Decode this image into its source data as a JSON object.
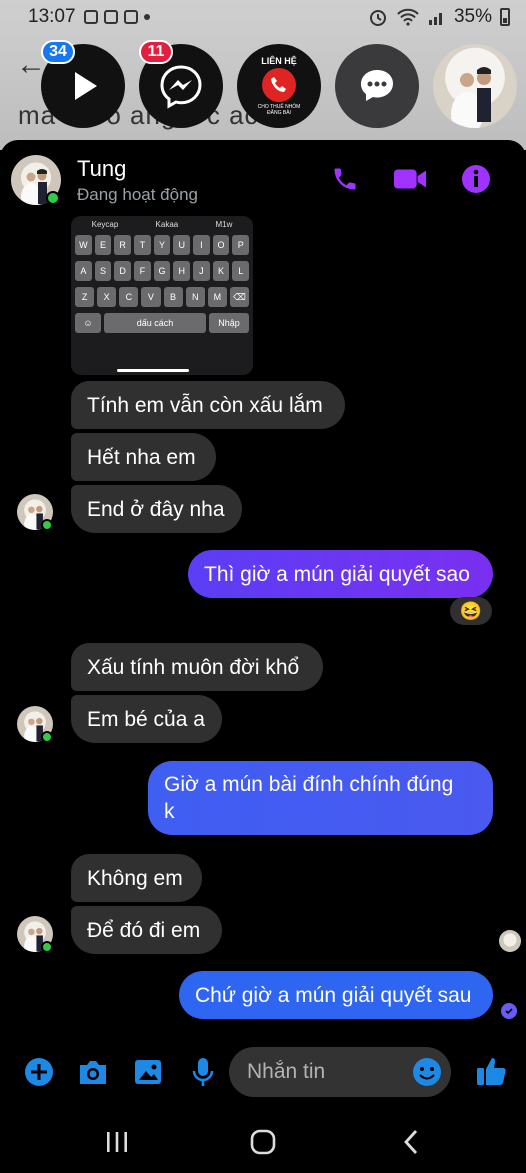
{
  "status_bar": {
    "time": "13:07",
    "battery": "35%"
  },
  "background": {
    "text_line": "ma    o So   ang    c   c  ac  v"
  },
  "chat_heads": [
    {
      "kind": "play",
      "badge": "34",
      "badge_color": "#1877f2"
    },
    {
      "kind": "messenger",
      "badge": "11",
      "badge_color": "#e41e3f"
    },
    {
      "kind": "lien-he",
      "title": "LIÊN HỆ",
      "caption_line1": "CHO THUÊ NHÓM",
      "caption_line2": "ĐĂNG BÀI"
    },
    {
      "kind": "chat"
    },
    {
      "kind": "avatar"
    }
  ],
  "header": {
    "name": "Tung",
    "presence": "Đang hoạt động"
  },
  "keyboard_image": {
    "suggestions": [
      "Keycap",
      "Kakaa",
      "M1w"
    ],
    "row1": [
      "W",
      "E",
      "R",
      "T",
      "Y",
      "U",
      "I",
      "O",
      "P"
    ],
    "row2": [
      "A",
      "S",
      "D",
      "F",
      "G",
      "H",
      "J",
      "K",
      "L"
    ],
    "row3": [
      "Z",
      "X",
      "C",
      "V",
      "B",
      "N",
      "M",
      "⌫"
    ],
    "space": "dấu cách",
    "enter": "Nhập"
  },
  "messages": [
    {
      "from": "them",
      "text": "Tính em vẫn còn xấu lắm"
    },
    {
      "from": "them",
      "text": "Hết nha em"
    },
    {
      "from": "them",
      "text": "End ở đây nha"
    },
    {
      "from": "me",
      "text": "Thì giờ a mún giải quyết sao",
      "reaction": "😆"
    },
    {
      "from": "them",
      "text": "Xấu tính muôn đời khổ"
    },
    {
      "from": "them",
      "text": "Em bé của a"
    },
    {
      "from": "me",
      "text_line1": "Giờ a mún bài đính chính đúng",
      "text_line2": "k"
    },
    {
      "from": "them",
      "text": "Không em"
    },
    {
      "from": "them",
      "text": "Để đó đi em"
    },
    {
      "from": "me",
      "text": "Chứ giờ a mún giải quyết sau"
    }
  ],
  "composer": {
    "placeholder": "Nhắn tin"
  },
  "colors": {
    "accent": "#a033ff",
    "composer_blue": "#1e88e5",
    "online": "#31cc46"
  }
}
